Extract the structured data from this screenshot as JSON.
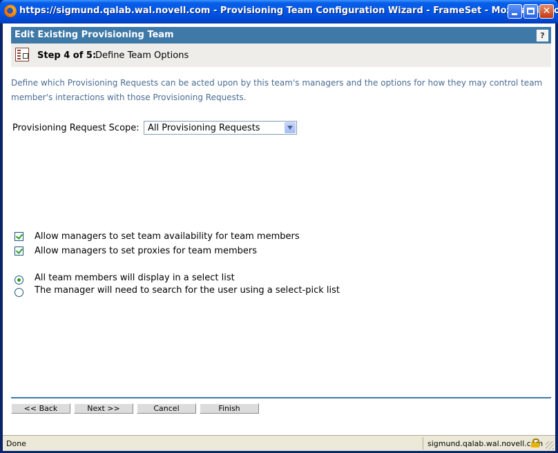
{
  "window": {
    "title": "https://sigmund.qalab.wal.novell.com - Provisioning Team Configuration Wizard - FrameSet - Mozilla Firefox",
    "icons": {
      "app": "firefox-icon",
      "minimize": "minimize-icon",
      "maximize": "maximize-icon",
      "close": "close-icon"
    },
    "close_glyph": "✕"
  },
  "header": {
    "title": "Edit Existing Provisioning Team",
    "help_label": "?"
  },
  "step": {
    "label": "Step 4 of 5:",
    "name": "Define Team Options",
    "icon": "wizard-step-icon"
  },
  "description": "Define which Provisioning Requests can be acted upon by this team's managers and the options for how they may control team member's interactions with those Provisioning Requests.",
  "scope": {
    "label": "Provisioning Request Scope:",
    "selected": "All Provisioning Requests"
  },
  "checkboxes": [
    {
      "label": "Allow managers to set team availability for team members",
      "checked": true
    },
    {
      "label": "Allow managers to set proxies for team members",
      "checked": true
    }
  ],
  "radios": [
    {
      "label": "All team members will display in a select list",
      "checked": true
    },
    {
      "label": "The manager will need to search for the user using a select-pick list",
      "checked": false
    }
  ],
  "buttons": {
    "back": "<< Back",
    "next": "Next >>",
    "cancel": "Cancel",
    "finish": "Finish"
  },
  "status": {
    "text": "Done",
    "host": "sigmund.qalab.wal.novell.com"
  },
  "colors": {
    "header_bar": "#3f79a8",
    "description_text": "#4a6c95",
    "check_mark": "#21a121"
  }
}
